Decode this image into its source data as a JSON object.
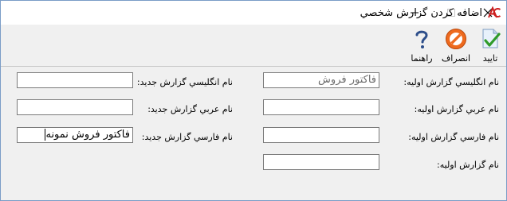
{
  "window": {
    "title": "اضافه کردن گزارش شخصي",
    "controls": {
      "minimize": "minimize",
      "maximize": "maximize",
      "close": "close"
    }
  },
  "toolbar": {
    "confirm_label": "تاييد",
    "cancel_label": "انصراف",
    "help_label": "راهنما"
  },
  "form": {
    "original_english_label": "نام انگليسي گزارش اوليه:",
    "original_english_value": "فاكتور فروش",
    "original_arabic_label": "نام عربي گزارش اوليه:",
    "original_arabic_value": "",
    "original_farsi_label": "نام فارسي گزارش اوليه:",
    "original_farsi_value": "",
    "original_name_label": "نام گزارش اوليه:",
    "original_name_value": "",
    "new_english_label": "نام انگليسي گزارش جديد:",
    "new_english_value": "",
    "new_arabic_label": "نام عربي گزارش جديد:",
    "new_arabic_value": "",
    "new_farsi_label": "نام فارسي گزارش جديد:",
    "new_farsi_value": "فاكتور فروش نمونه"
  }
}
